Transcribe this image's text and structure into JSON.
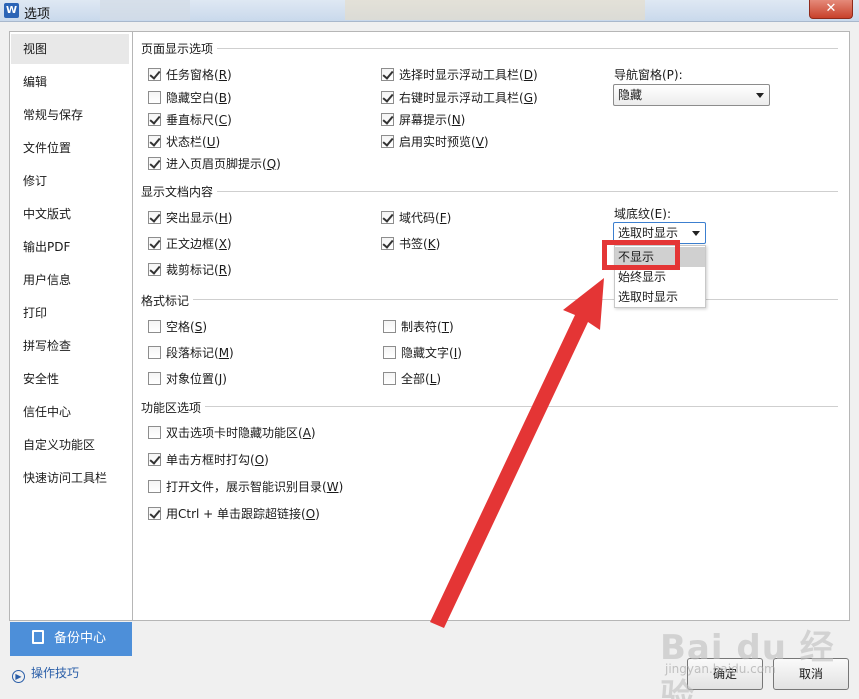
{
  "window": {
    "title": "选项",
    "app_icon": "W",
    "close_label": "✕"
  },
  "nav": {
    "items": [
      {
        "label": "视图",
        "selected": true
      },
      {
        "label": "编辑"
      },
      {
        "label": "常规与保存"
      },
      {
        "label": "文件位置"
      },
      {
        "label": "修订"
      },
      {
        "label": "中文版式"
      },
      {
        "label": "输出PDF"
      },
      {
        "label": "用户信息"
      },
      {
        "label": "打印"
      },
      {
        "label": "拼写检查"
      },
      {
        "label": "安全性"
      },
      {
        "label": "信任中心"
      },
      {
        "label": "自定义功能区"
      },
      {
        "label": "快速访问工具栏"
      }
    ],
    "backup_label": "备份中心",
    "tips_label": "操作技巧"
  },
  "page_display": {
    "title": "页面显示选项",
    "col1": [
      {
        "text": "任务窗格(",
        "key": "R",
        "end": ")",
        "checked": true
      },
      {
        "text": "隐藏空白(",
        "key": "B",
        "end": ")",
        "checked": false
      },
      {
        "text": "垂直标尺(",
        "key": "C",
        "end": ")",
        "checked": true
      },
      {
        "text": "状态栏(",
        "key": "U",
        "end": ")",
        "checked": true
      },
      {
        "text": "进入页眉页脚提示(",
        "key": "Q",
        "end": ")",
        "checked": true
      }
    ],
    "col2": [
      {
        "text": "选择时显示浮动工具栏(",
        "key": "D",
        "end": ")",
        "checked": true
      },
      {
        "text": "右键时显示浮动工具栏(",
        "key": "G",
        "end": ")",
        "checked": true
      },
      {
        "text": "屏幕提示(",
        "key": "N",
        "end": ")",
        "checked": true
      },
      {
        "text": "启用实时预览(",
        "key": "V",
        "end": ")",
        "checked": true
      }
    ],
    "nav_pane_label": "导航窗格(P):",
    "nav_pane_value": "隐藏"
  },
  "doc_content": {
    "title": "显示文档内容",
    "col1": [
      {
        "text": "突出显示(",
        "key": "H",
        "end": ")",
        "checked": true
      },
      {
        "text": "正文边框(",
        "key": "X",
        "end": ")",
        "checked": true
      },
      {
        "text": "裁剪标记(",
        "key": "R",
        "end": ")",
        "checked": true
      }
    ],
    "col2": [
      {
        "text": "域代码(",
        "key": "F",
        "end": ")",
        "checked": true
      },
      {
        "text": "书签(",
        "key": "K",
        "end": ")",
        "checked": true
      }
    ],
    "shading_label": "域底纹(E):",
    "shading_value": "选取时显示",
    "shading_options": [
      "不显示",
      "始终显示",
      "选取时显示"
    ]
  },
  "format_marks": {
    "title": "格式标记",
    "col1": [
      {
        "text": "空格(",
        "key": "S",
        "end": ")",
        "checked": false
      },
      {
        "text": "段落标记(",
        "key": "M",
        "end": ")",
        "checked": false
      },
      {
        "text": "对象位置(",
        "key": "J",
        "end": ")",
        "checked": false
      }
    ],
    "col2": [
      {
        "text": "制表符(",
        "key": "T",
        "end": ")",
        "checked": false
      },
      {
        "text": "隐藏文字(",
        "key": "I",
        "end": ")",
        "checked": false
      },
      {
        "text": "全部(",
        "key": "L",
        "end": ")",
        "checked": false
      }
    ]
  },
  "ribbon": {
    "title": "功能区选项",
    "items": [
      {
        "text": "双击选项卡时隐藏功能区(",
        "key": "A",
        "end": ")",
        "checked": false
      },
      {
        "text": "单击方框时打勾(",
        "key": "O",
        "end": ")",
        "checked": true
      },
      {
        "text": "打开文件，展示智能识别目录(",
        "key": "W",
        "end": ")",
        "checked": false
      },
      {
        "text": "用Ctrl + 单击跟踪超链接(",
        "key": "O",
        "end": ")",
        "checked": true
      }
    ]
  },
  "buttons": {
    "ok": "确定",
    "cancel": "取消"
  },
  "watermark": {
    "logo": "Bai du 经验",
    "url": "jingyan.baidu.com"
  },
  "colors": {
    "accent": "#4d8fd9",
    "highlight_box": "#e43535",
    "arrow": "#e43535"
  }
}
